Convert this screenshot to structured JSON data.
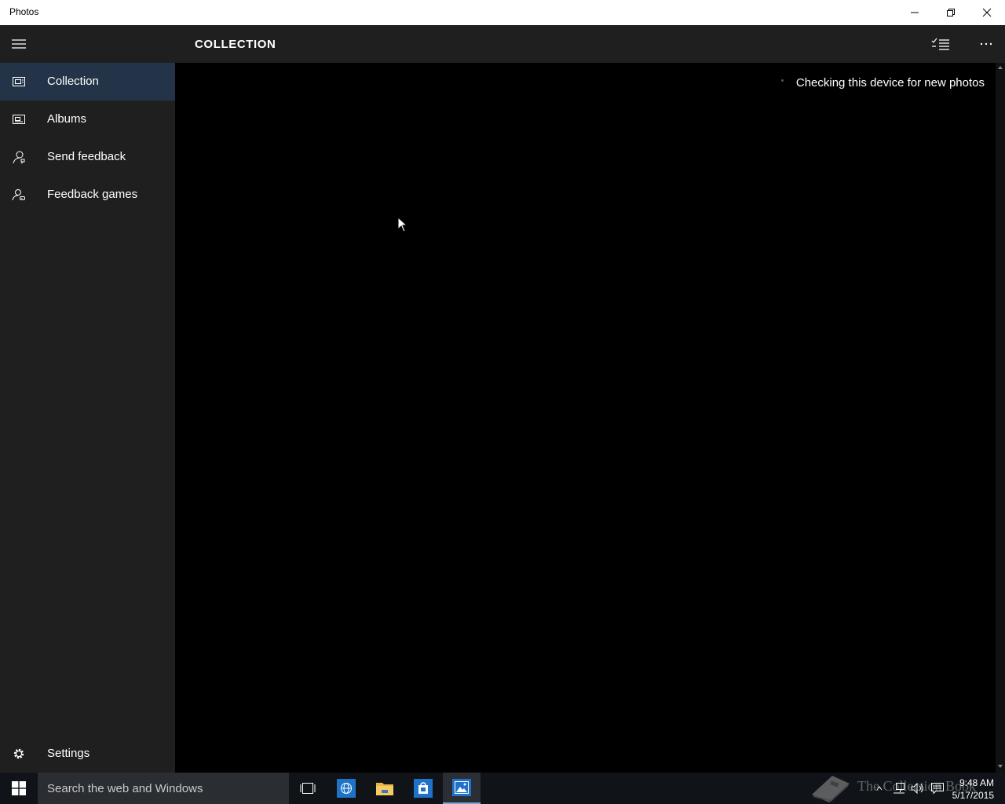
{
  "window": {
    "title": "Photos",
    "minimize_icon": "minimize-icon",
    "restore_icon": "restore-icon",
    "close_icon": "close-icon"
  },
  "header": {
    "title": "COLLECTION",
    "select_icon": "select-list-icon",
    "more_icon": "more-icon"
  },
  "sidebar": {
    "items": [
      {
        "label": "Collection",
        "icon": "collection-icon",
        "selected": true
      },
      {
        "label": "Albums",
        "icon": "albums-icon",
        "selected": false
      },
      {
        "label": "Send feedback",
        "icon": "send-feedback-icon",
        "selected": false
      },
      {
        "label": "Feedback games",
        "icon": "feedback-games-icon",
        "selected": false
      }
    ],
    "settings": {
      "label": "Settings",
      "icon": "gear-icon"
    }
  },
  "content": {
    "status": "Checking this device for new photos"
  },
  "taskbar": {
    "search_placeholder": "Search the web and Windows",
    "watermark": "The Collection Book",
    "time": "9:48 AM",
    "date": "5/17/2015"
  },
  "colors": {
    "accent": "#243448",
    "chrome": "#1f1f1f",
    "background": "#000000"
  }
}
